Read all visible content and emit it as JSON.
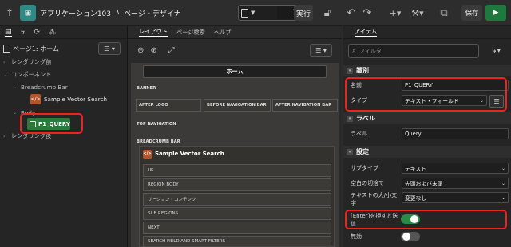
{
  "topbar": {
    "app_name": "アプリケーション103",
    "separator": "\\",
    "designer_label": "ページ・デザイナ",
    "page_number": "1",
    "run_label": "実行",
    "save_label": "保存"
  },
  "left_panel": {
    "header_title": "ページ1: ホーム",
    "tree": {
      "before_render": "レンダリング前",
      "components": "コンポーネント",
      "breadcrumb_bar": "Breadcrumb Bar",
      "sample_vector_search": "Sample Vector Search",
      "body": "Body",
      "p1_query": "P1_QUERY",
      "after_render": "レンダリング後"
    }
  },
  "middle_panel": {
    "tabs": [
      "レイアウト",
      "ページ検索",
      "ヘルプ"
    ],
    "home_label": "ホーム",
    "banner": "BANNER",
    "after_logo": "AFTER LOGO",
    "before_nav": "BEFORE NAVIGATION BAR",
    "after_nav": "AFTER NAVIGATION BAR",
    "top_navigation": "TOP NAVIGATION",
    "breadcrumb_bar": "BREADCRUMB BAR",
    "region_title": "Sample Vector Search",
    "region_rows": [
      "UP",
      "REGION BODY",
      "リージョン・コンテンツ",
      "SUB REGIONS",
      "NEXT",
      "SEARCH FIELD AND SMART FILTERS"
    ]
  },
  "right_panel": {
    "tab": "アイテム",
    "filter_placeholder": "フィルタ",
    "sections": {
      "identification": "識別",
      "label": "ラベル",
      "settings": "設定"
    },
    "props": {
      "name_label": "名前",
      "name_value": "P1_QUERY",
      "type_label": "タイプ",
      "type_value": "テキスト・フィールド",
      "label_label": "ラベル",
      "label_value": "Query",
      "subtype_label": "サブタイプ",
      "subtype_value": "テキスト",
      "trim_label": "空白の切捨て",
      "trim_value": "先頭および末尾",
      "case_label_1": "テキストの大/小文",
      "case_label_2": "字",
      "case_value": "変更なし",
      "enter_label_1": "[Enter]を押すと送",
      "enter_label_2": "信",
      "enter_submit": true,
      "disabled_label": "無効",
      "disabled": false
    }
  }
}
